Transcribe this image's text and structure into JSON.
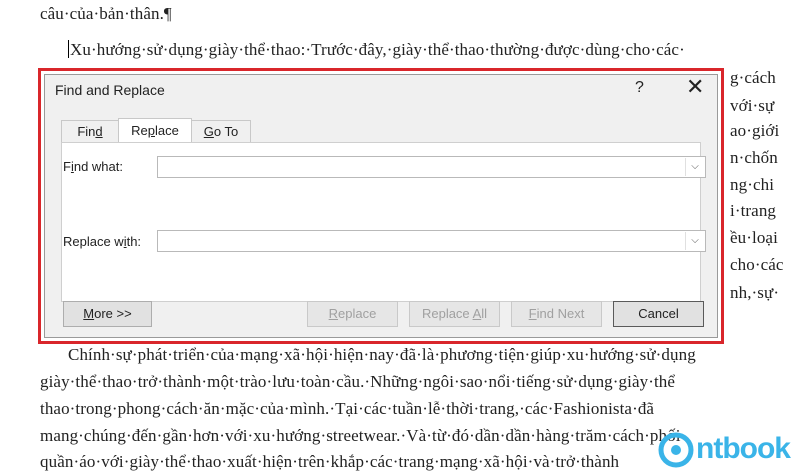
{
  "document": {
    "line_top": "câu·của·bản·thân.¶",
    "line_cursor": "Xu·hướng·sử·dụng·giày·thể·thao:·Trước·đây,·giày·thể·thao·thường·được·dùng·cho·các·",
    "right_fragments": [
      "g·cách",
      "với·sự",
      "ao·giới",
      "n·chốn",
      "ng·chi",
      "i·trang",
      "ều·loại",
      "cho·các",
      "nh,·sự·"
    ],
    "para2": [
      "Chính·sự·phát·triển·của·mạng·xã·hội·hiện·nay·đã·là·phương·tiện·giúp·xu·hướng·sử·dụng",
      "giày·thể·thao·trở·thành·một·trào·lưu·toàn·cầu.·Những·ngôi·sao·nổi·tiếng·sử·dụng·giày·thể",
      "thao·trong·phong·cách·ăn·mặc·của·mình.·Tại·các·tuần·lễ·thời·trang,·các·Fashionista·đã",
      "mang·chúng·đến·gần·hơn·với·xu·hướng·streetwear.·Và·từ·đó·dần·dần·hàng·trăm·cách·phối",
      "quần·áo·với·giày·thể·thao·xuất·hiện·trên·khắp·các·trang·mạng·xã·hội·và·trở·thành"
    ]
  },
  "dialog": {
    "title": "Find and Replace",
    "help_label": "?",
    "close_label": "✕",
    "tabs": [
      {
        "pre": "Fin",
        "key": "d",
        "post": ""
      },
      {
        "pre": "Re",
        "key": "p",
        "post": "lace"
      },
      {
        "pre": "",
        "key": "G",
        "post": "o To"
      }
    ],
    "find_label": {
      "pre": "F",
      "key": "i",
      "post": "nd what:"
    },
    "find_value": "",
    "replace_label": {
      "pre": "Replace w",
      "key": "i",
      "post": "th:"
    },
    "replace_value": "",
    "buttons": {
      "more": {
        "pre": "",
        "key": "M",
        "post": "ore >>"
      },
      "replace": {
        "pre": "",
        "key": "R",
        "post": "eplace"
      },
      "replace_all": {
        "pre": "Replace ",
        "key": "A",
        "post": "ll"
      },
      "find_next": {
        "pre": "",
        "key": "F",
        "post": "ind Next"
      },
      "cancel": "Cancel"
    }
  },
  "watermark": {
    "text": "ntbook"
  },
  "colors": {
    "highlight_frame": "#d9262b",
    "logo": "#3ab4e8"
  }
}
